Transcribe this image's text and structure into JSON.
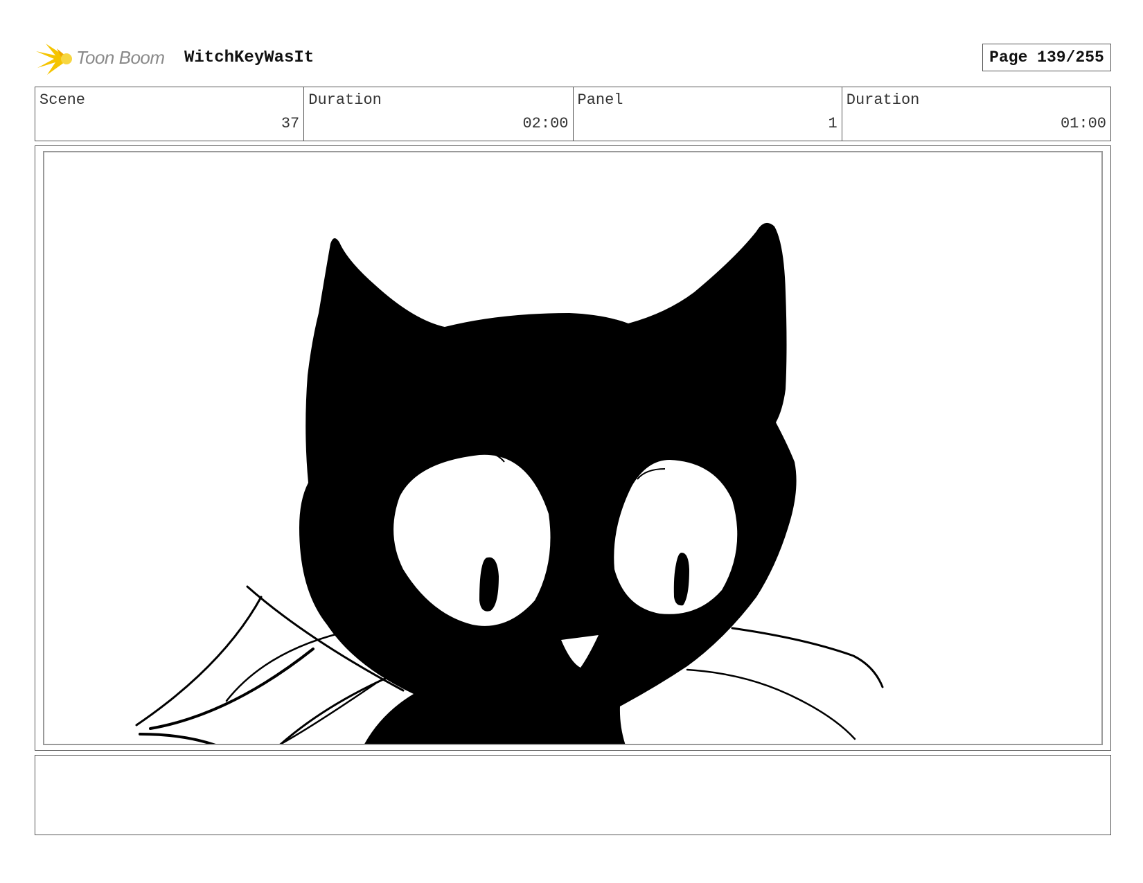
{
  "header": {
    "logo_text": "Toon Boom",
    "project_title": "WitchKeyWasIt",
    "page_label": "Page 139/255"
  },
  "info": {
    "scene_label": "Scene",
    "scene_value": "37",
    "scene_duration_label": "Duration",
    "scene_duration_value": "02:00",
    "panel_label": "Panel",
    "panel_value": "1",
    "panel_duration_label": "Duration",
    "panel_duration_value": "01:00"
  },
  "notes": {
    "text": ""
  },
  "colors": {
    "logo_accent": "#f5c400",
    "ink": "#000000"
  }
}
